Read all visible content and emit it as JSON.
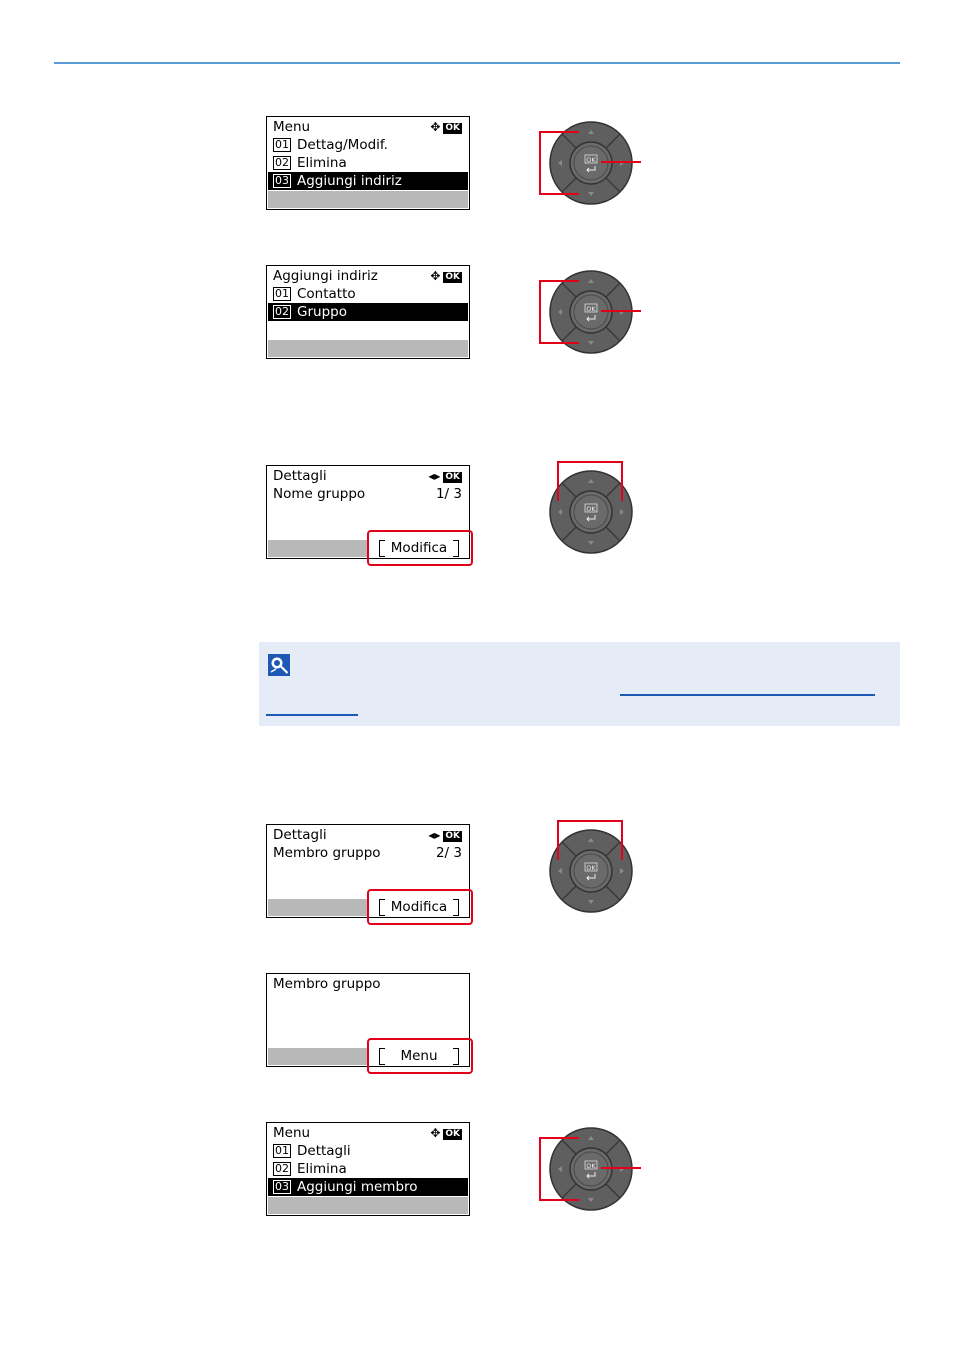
{
  "screens": [
    {
      "header": "Menu",
      "items": [
        {
          "num": "01",
          "label": "Dettag/Modif."
        },
        {
          "num": "02",
          "label": "Elimina"
        },
        {
          "num": "03",
          "label": "Aggiungi indiriz"
        }
      ],
      "ok": "OK"
    },
    {
      "header": "Aggiungi indiriz",
      "items": [
        {
          "num": "01",
          "label": "Contatto"
        },
        {
          "num": "02",
          "label": "Gruppo"
        }
      ],
      "ok": "OK"
    },
    {
      "header": "Dettagli",
      "line": "Nome gruppo",
      "page": "1/ 3",
      "softkey": "Modifica",
      "ok": "OK"
    },
    {
      "header": "Dettagli",
      "line": "Membro gruppo",
      "page": "2/ 3",
      "softkey": "Modifica",
      "ok": "OK"
    },
    {
      "header": "Membro gruppo",
      "softkey": "Menu"
    },
    {
      "header": "Menu",
      "items": [
        {
          "num": "01",
          "label": "Dettagli"
        },
        {
          "num": "02",
          "label": "Elimina"
        },
        {
          "num": "03",
          "label": "Aggiungi membro"
        }
      ],
      "ok": "OK"
    }
  ],
  "dpad": {
    "center_label": "OK"
  },
  "colors": {
    "accent_line": "#5b9bd5",
    "highlight": "#e2001a",
    "note_bg": "#e5ecf8",
    "link": "#1d58b5"
  },
  "icons": {
    "note": "note-icon",
    "dpad": "dpad-icon"
  }
}
